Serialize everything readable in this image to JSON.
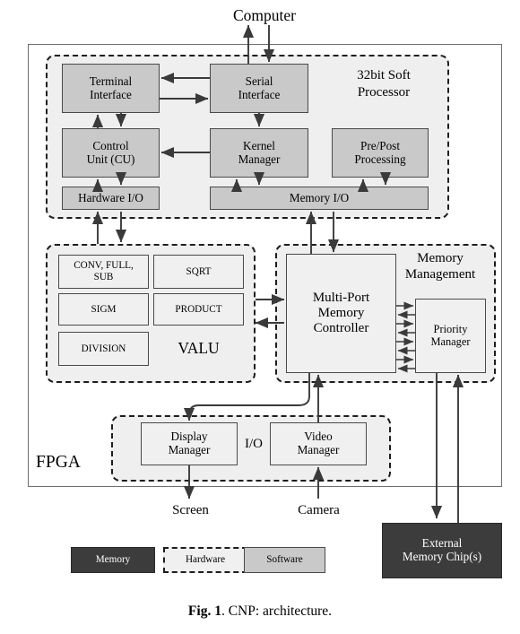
{
  "figure": {
    "caption_bold": "Fig. 1",
    "caption_rest": ". CNP: architecture."
  },
  "external_labels": {
    "computer": "Computer",
    "screen": "Screen",
    "camera": "Camera",
    "fpga": "FPGA"
  },
  "soft_processor": {
    "group_label_line1": "32bit Soft",
    "group_label_line2": "Processor",
    "blocks": [
      {
        "id": "terminal-interface",
        "line1": "Terminal",
        "line2": "Interface",
        "type": "software"
      },
      {
        "id": "serial-interface",
        "line1": "Serial",
        "line2": "Interface",
        "type": "software"
      },
      {
        "id": "control-unit",
        "line1": "Control",
        "line2": "Unit (CU)",
        "type": "software"
      },
      {
        "id": "kernel-manager",
        "line1": "Kernel",
        "line2": "Manager",
        "type": "software"
      },
      {
        "id": "pre-post-processing",
        "line1": "Pre/Post",
        "line2": "Processing",
        "type": "software"
      },
      {
        "id": "hardware-io",
        "line1": "Hardware I/O",
        "line2": "",
        "type": "software"
      },
      {
        "id": "memory-io",
        "line1": "Memory I/O",
        "line2": "",
        "type": "software"
      }
    ]
  },
  "valu": {
    "group_label": "VALU",
    "units": [
      {
        "id": "conv-full-sub",
        "line1": "CONV, FULL,",
        "line2": "SUB"
      },
      {
        "id": "sqrt",
        "line1": "SQRT",
        "line2": ""
      },
      {
        "id": "sigm",
        "line1": "SIGM",
        "line2": ""
      },
      {
        "id": "product",
        "line1": "PRODUCT",
        "line2": ""
      },
      {
        "id": "division",
        "line1": "DIVISION",
        "line2": ""
      }
    ]
  },
  "memory_management": {
    "group_label_line1": "Memory",
    "group_label_line2": "Management",
    "controller": {
      "line1": "Multi-Port",
      "line2": "Memory",
      "line3": "Controller"
    },
    "priority_manager": {
      "line1": "Priority",
      "line2": "Manager"
    },
    "bus_pairs": 4
  },
  "io_section": {
    "group_label": "I/O",
    "blocks": [
      {
        "id": "display-manager",
        "line1": "Display",
        "line2": "Manager"
      },
      {
        "id": "video-manager",
        "line1": "Video",
        "line2": "Manager"
      }
    ]
  },
  "external_memory": {
    "line1": "External",
    "line2": "Memory Chip(s)"
  },
  "legend": [
    {
      "id": "legend-memory",
      "label": "Memory",
      "type": "memory"
    },
    {
      "id": "legend-hardware",
      "label": "Hardware",
      "type": "hardware"
    },
    {
      "id": "legend-software",
      "label": "Software",
      "type": "software"
    }
  ],
  "colors": {
    "memory_fill": "#3c3c3c",
    "memory_text": "#ffffff",
    "hardware_fill": "#f0f0f0",
    "software_fill": "#c9c9c9",
    "group_fill": "#efefef",
    "stroke": "#4a4a4a",
    "frame_stroke": "#6e6e6e"
  }
}
